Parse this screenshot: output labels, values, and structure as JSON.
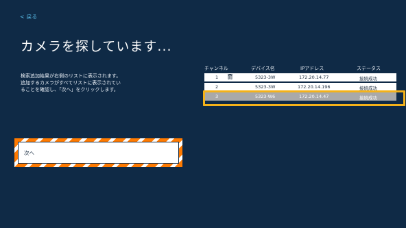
{
  "nav": {
    "back_label": "< 戻る"
  },
  "page": {
    "title": "カメラを探しています...",
    "instructions": [
      "検索追加結果が右側のリストに表示されます。",
      "追加するカメラがすべてリストに表示されてい",
      "ることを確認し、「次へ」をクリックします。"
    ]
  },
  "table": {
    "columns": [
      "チャンネル",
      "デバイス名",
      "IPアドレス",
      "ステータス"
    ],
    "rows": [
      {
        "channel": "1",
        "device": "5323-3W",
        "ip": "172.20.14.77",
        "status": "接続成功",
        "icon": "trash-icon"
      },
      {
        "channel": "2",
        "device": "5323-3W",
        "ip": "172.20.14.196",
        "status": "接続成功"
      },
      {
        "channel": "3",
        "device": "5323-W6",
        "ip": "172.20.14.47",
        "status": "接続成功",
        "selected": true
      }
    ]
  },
  "buttons": {
    "next_label": "次へ"
  },
  "colors": {
    "background": "#0f2a46",
    "accent": "#5ec6f2",
    "highlight": "#ff7a00",
    "row_highlight": "#f4b21a"
  }
}
